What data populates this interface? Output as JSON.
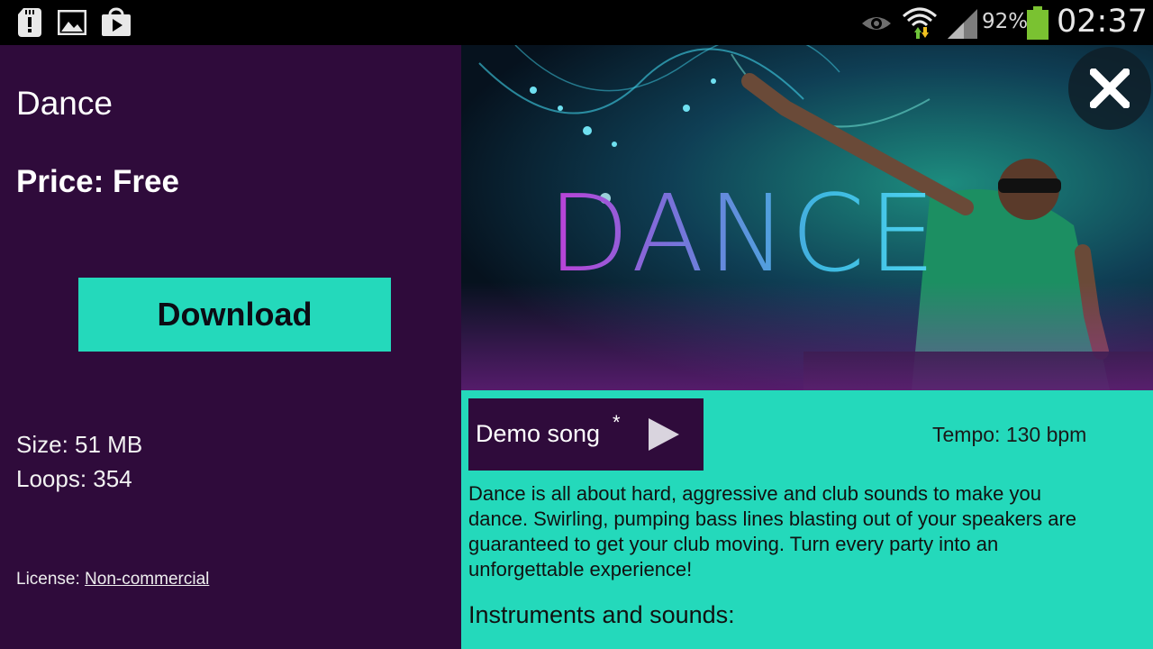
{
  "status_bar": {
    "battery_percent": "92%",
    "clock": "02:37",
    "icons": [
      "sd-card-alert-icon",
      "image-icon",
      "play-store-icon",
      "eye-icon",
      "wifi-icon",
      "signal-icon",
      "battery-icon"
    ],
    "battery_color": "#7ac231"
  },
  "pack": {
    "title": "Dance",
    "price": "Price: Free",
    "download_label": "Download",
    "size": "Size: 51 MB",
    "loops": "Loops: 354",
    "license_prefix": "License: ",
    "license_link": "Non-commercial"
  },
  "banner": {
    "word": "DANCE"
  },
  "details": {
    "demo_label": "Demo song",
    "demo_mark": "*",
    "tempo": "Tempo: 130 bpm",
    "description": "Dance is all about hard, aggressive and club sounds to make you dance. Swirling, pumping bass lines blasting out of your speakers are guaranteed to get your club moving. Turn every party into an unforgettable experience!",
    "instruments_heading": "Instruments and sounds:"
  },
  "colors": {
    "left_panel": "#2f0b3b",
    "accent": "#24d9bb"
  }
}
